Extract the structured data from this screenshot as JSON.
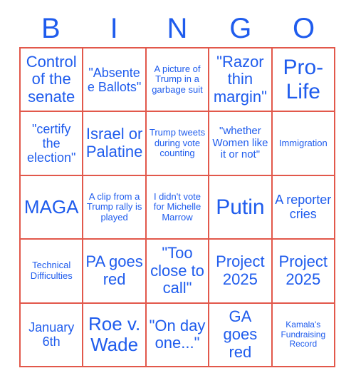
{
  "card": {
    "title": "BINGO",
    "colors": {
      "text_blue": "#1f5ced",
      "border_red": "#e2584b",
      "background": "#ffffff"
    },
    "header_letters": [
      "B",
      "I",
      "N",
      "G",
      "O"
    ],
    "rows": [
      [
        {
          "text": "Control of the senate",
          "size": "lg"
        },
        {
          "text": "\"Absentee Ballots\"",
          "size": "md"
        },
        {
          "text": "A picture of Trump in a garbage suit",
          "size": "xs"
        },
        {
          "text": "\"Razor thin margin\"",
          "size": "lg"
        },
        {
          "text": "Pro-Life",
          "size": "xxl"
        }
      ],
      [
        {
          "text": "\"certify the election\"",
          "size": "md"
        },
        {
          "text": "Israel or Palatine",
          "size": "lg"
        },
        {
          "text": "Trump tweets during vote counting",
          "size": "xs"
        },
        {
          "text": "\"whether Women like it or not\"",
          "size": "sm"
        },
        {
          "text": "Immigration",
          "size": "xs"
        }
      ],
      [
        {
          "text": "MAGA",
          "size": "xl"
        },
        {
          "text": "A clip from a Trump rally is played",
          "size": "xs"
        },
        {
          "text": "I didn't vote for Michelle Marrow",
          "size": "xs"
        },
        {
          "text": "Putin",
          "size": "xxl"
        },
        {
          "text": "A reporter cries",
          "size": "md"
        }
      ],
      [
        {
          "text": "Technical Difficulties",
          "size": "xs"
        },
        {
          "text": "PA goes red",
          "size": "lg"
        },
        {
          "text": "\"Too close to call\"",
          "size": "lg"
        },
        {
          "text": "Project 2025",
          "size": "lg"
        },
        {
          "text": "Project 2025",
          "size": "lg"
        }
      ],
      [
        {
          "text": "January 6th",
          "size": "md"
        },
        {
          "text": "Roe v. Wade",
          "size": "xl"
        },
        {
          "text": "\"On day one...\"",
          "size": "lg"
        },
        {
          "text": "GA goes red",
          "size": "lg"
        },
        {
          "text": "Kamala's Fundraising Record",
          "size": "xxs"
        }
      ]
    ]
  }
}
